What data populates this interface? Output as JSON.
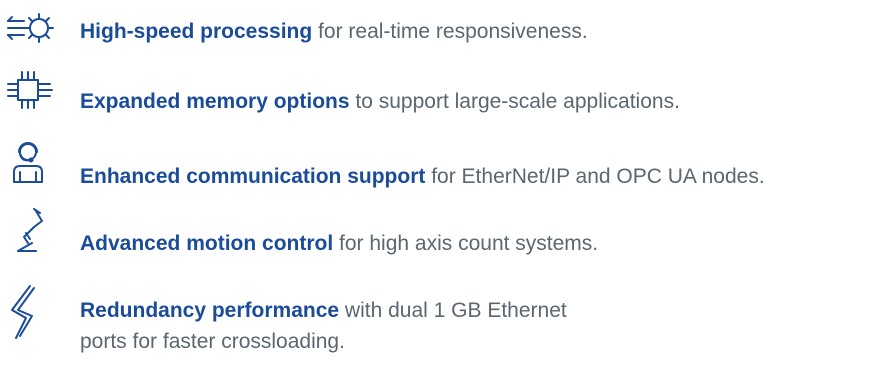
{
  "colors": {
    "accent": "#1a4c9a",
    "body_text": "#5b6670",
    "icon_stroke": "#1a4c9a"
  },
  "features": [
    {
      "icon": "gear-speed-icon",
      "strong": "High-speed processing",
      "rest": " for real-time responsiveness."
    },
    {
      "icon": "chip-icon",
      "strong": "Expanded memory options",
      "rest": " to support large-scale applications."
    },
    {
      "icon": "headset-operator-icon",
      "strong": "Enhanced communication support",
      "rest": " for EtherNet/IP and OPC UA nodes."
    },
    {
      "icon": "robot-arm-icon",
      "strong": "Advanced motion control",
      "rest": " for high axis count systems."
    },
    {
      "icon": "lightning-icon",
      "strong": "Redundancy performance",
      "rest": " with dual 1 GB Ethernet ports for faster crossloading."
    }
  ]
}
